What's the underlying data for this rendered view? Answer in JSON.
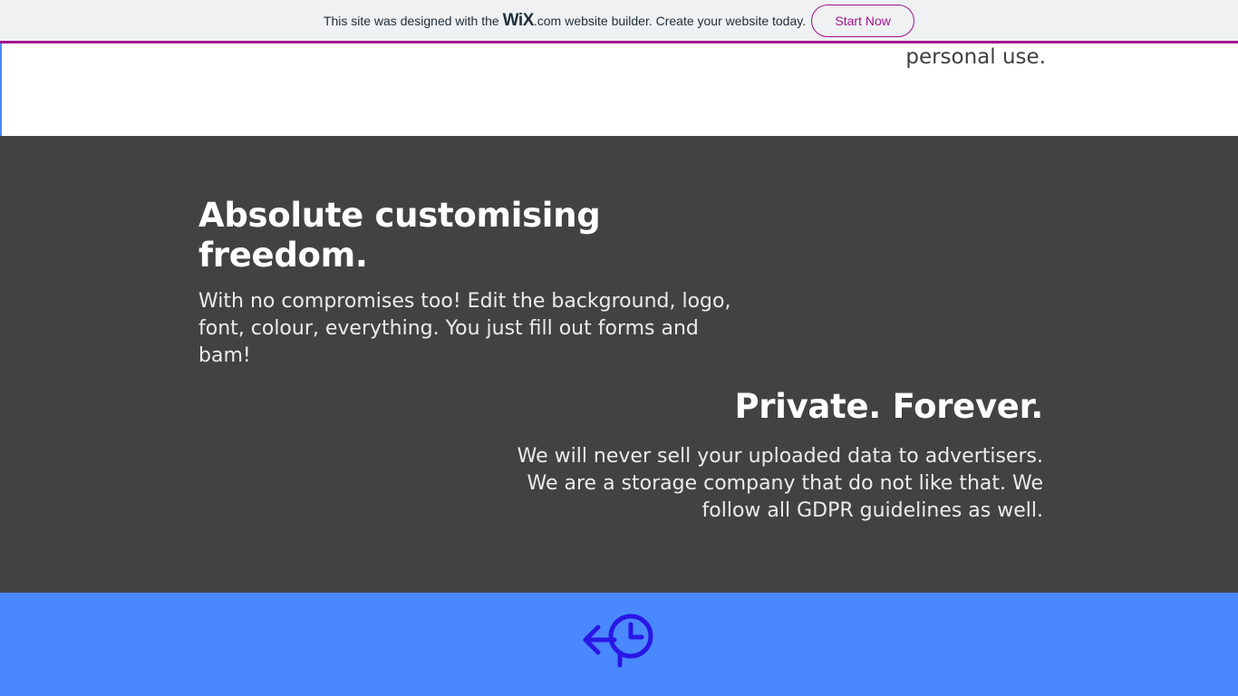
{
  "banner": {
    "text_before": "This site was designed with the",
    "logo_word": "WiX",
    "logo_suffix": ".com",
    "text_after": "website builder. Create your website today.",
    "cta_label": "Start Now",
    "accent_color": "#a0138e"
  },
  "top_strip": {
    "trailing_text": "personal use."
  },
  "features": [
    {
      "title": "Absolute customising freedom.",
      "body": "With no compromises too! Edit the background, logo, font, colour, everything. You just fill out forms and bam!"
    },
    {
      "title": "Private. Forever.",
      "body": "We will never sell your uploaded data to advertisers. We are a storage company that do not like that. We follow all GDPR guidelines as well."
    }
  ],
  "footer": {
    "logo_icon": "back-arrow-clock-icon",
    "background_color": "#4a88ff",
    "icon_color": "#2a16e6"
  },
  "colors": {
    "dark_section": "#424242",
    "text_light": "#ffffff"
  }
}
